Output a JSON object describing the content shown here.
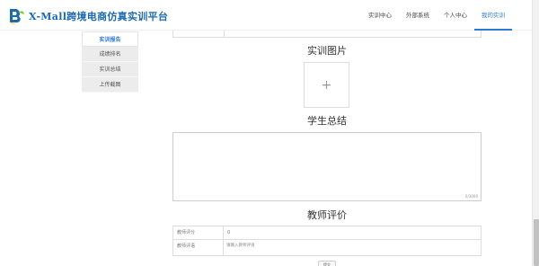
{
  "brand": {
    "title": "X-Mall跨境电商仿真实训平台",
    "logo_letters": "B",
    "colors": {
      "primary": "#1b6ab0",
      "accent": "#2e7ad1",
      "logo_green": "#7fc83a"
    }
  },
  "nav": {
    "items": [
      {
        "label": "实训中心"
      },
      {
        "label": "外部系统"
      },
      {
        "label": "个人中心"
      },
      {
        "label": "我的实训"
      }
    ],
    "active_index": 3
  },
  "sidebar": {
    "items": [
      {
        "label": "实训报告"
      },
      {
        "label": "成绩排名"
      },
      {
        "label": "实训总结"
      },
      {
        "label": "上传截图"
      }
    ],
    "active_index": 0
  },
  "main": {
    "images_title": "实训图片",
    "upload_icon": "plus-icon",
    "upload_glyph": "+",
    "summary_title": "学生总结",
    "summary_value": "",
    "summary_counter": "0/3000",
    "teacher_title": "教师评价",
    "eval_rows": [
      {
        "label": "教师评分",
        "value": "0"
      },
      {
        "label": "教师评语",
        "placeholder": "请输入教师评语"
      }
    ],
    "submit_label": "提交"
  }
}
